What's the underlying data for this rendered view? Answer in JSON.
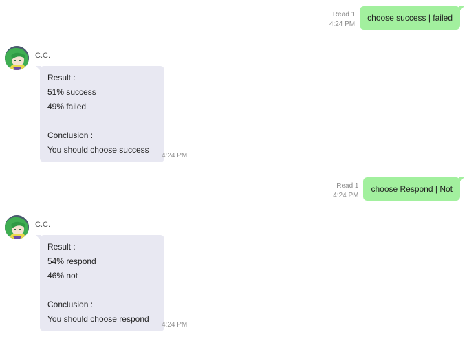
{
  "messages": [
    {
      "type": "outgoing",
      "read_label": "Read 1",
      "time": "4:24 PM",
      "text": "choose success | failed"
    },
    {
      "type": "incoming",
      "sender": "C.C.",
      "lines": [
        "Result :",
        "51% success",
        "49% failed",
        "",
        "Conclusion :",
        "You should choose success"
      ],
      "time": "4:24 PM"
    },
    {
      "type": "outgoing",
      "read_label": "Read 1",
      "time": "4:24 PM",
      "text": "choose Respond | Not"
    },
    {
      "type": "incoming",
      "sender": "C.C.",
      "lines": [
        "Result :",
        "54% respond",
        "46% not",
        "",
        "Conclusion :",
        "You should choose respond"
      ],
      "time": "4:24 PM"
    }
  ],
  "colors": {
    "outgoing_bubble": "#a2f09e",
    "incoming_bubble": "#e8e8f2",
    "meta_text": "#8c8c8c"
  }
}
